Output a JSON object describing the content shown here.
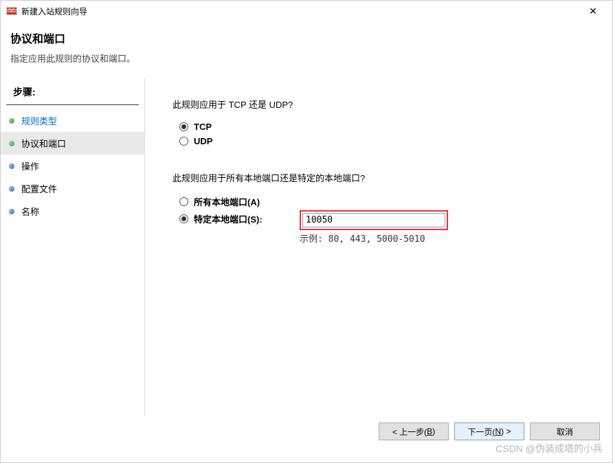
{
  "window": {
    "title": "新建入站规则向导",
    "close": "✕"
  },
  "header": {
    "title": "协议和端口",
    "subtitle": "指定应用此规则的协议和端口。"
  },
  "sidebar": {
    "heading": "步骤:",
    "steps": [
      {
        "label": "规则类型",
        "bullet": "green",
        "link": true,
        "active": false
      },
      {
        "label": "协议和端口",
        "bullet": "green",
        "link": false,
        "active": true
      },
      {
        "label": "操作",
        "bullet": "blue",
        "link": false,
        "active": false
      },
      {
        "label": "配置文件",
        "bullet": "blue",
        "link": false,
        "active": false
      },
      {
        "label": "名称",
        "bullet": "blue",
        "link": false,
        "active": false
      }
    ]
  },
  "main": {
    "q1": "此规则应用于 TCP 还是 UDP?",
    "protocol": {
      "tcp": "TCP",
      "udp": "UDP",
      "selected": "tcp"
    },
    "q2": "此规则应用于所有本地端口还是特定的本地端口?",
    "ports": {
      "all": "所有本地端口(A)",
      "specific": "特定本地端口(S):",
      "selected": "specific",
      "value": "10050",
      "example": "示例: 80, 443, 5000-5010"
    }
  },
  "buttons": {
    "back_prefix": "< 上一步(",
    "back_letter": "B",
    "back_suffix": ")",
    "next_prefix": "下一页(",
    "next_letter": "N",
    "next_suffix": ") >",
    "cancel": "取消"
  },
  "watermark": "CSDN @伪装成塔的小兵"
}
